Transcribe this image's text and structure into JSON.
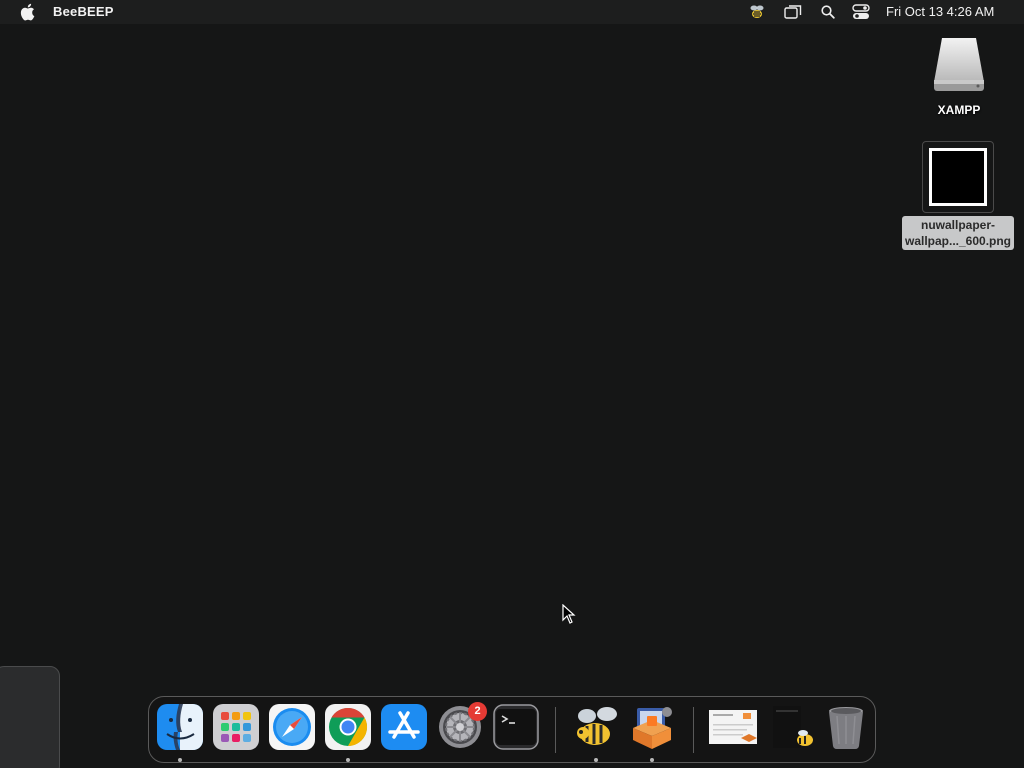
{
  "menubar": {
    "app_name": "BeeBEEP",
    "clock": "Fri Oct 13  4:26 AM",
    "icons": [
      "apple-logo-icon",
      "beebeep-status-icon",
      "screen-mirroring-icon",
      "spotlight-search-icon",
      "control-center-icon"
    ]
  },
  "desktop": {
    "icons": [
      {
        "label": "XAMPP",
        "icon": "drive-icon"
      },
      {
        "label": "nuwallpaper-wallpap..._600.png",
        "label_lines": [
          "nuwallpaper-",
          "wallpap..._600.png"
        ],
        "icon": "image-file-icon"
      }
    ]
  },
  "dock": {
    "apps": [
      "Finder",
      "Launchpad",
      "Safari",
      "Google Chrome",
      "App Store",
      "System Settings",
      "Terminal",
      "BeeBEEP",
      "XAMPP"
    ],
    "documents": [
      "document-thumbnail",
      "screenshot-thumbnail",
      "Trash"
    ],
    "badges": {
      "system_settings": "2"
    },
    "running": [
      "Finder",
      "Google Chrome",
      "BeeBEEP",
      "XAMPP"
    ]
  },
  "colors": {
    "desktop_bg": "#151616",
    "menubar_bg": "#1d1e1e",
    "badge_red": "#e53a34",
    "chrome_red": "#db4437",
    "chrome_yellow": "#f4b400",
    "chrome_green": "#0f9d58",
    "chrome_blue": "#4285f4"
  }
}
